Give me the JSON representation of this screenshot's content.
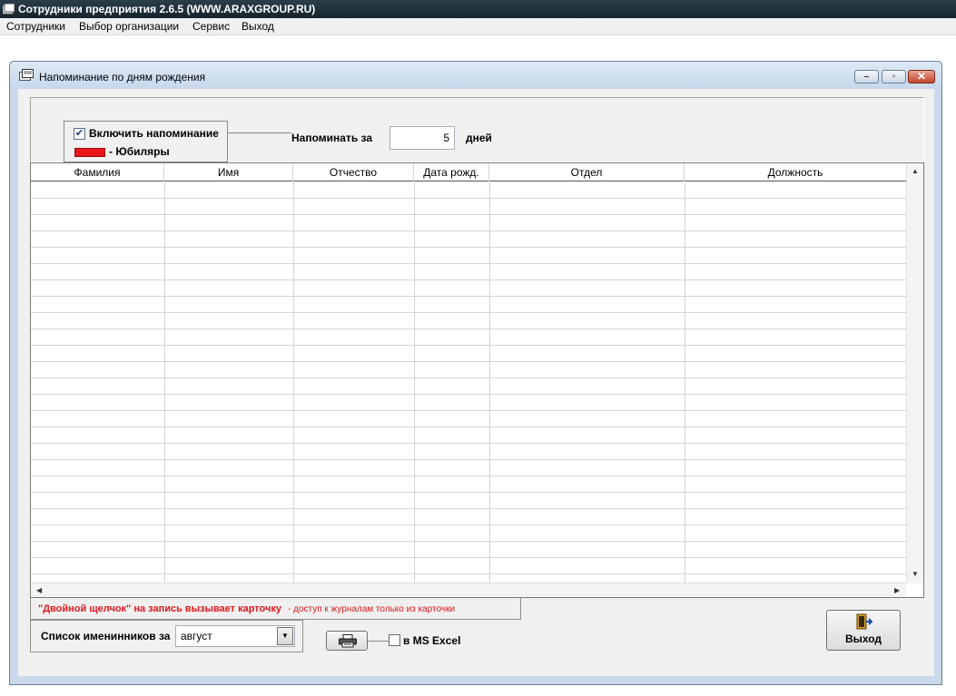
{
  "app": {
    "title": "Сотрудники предприятия 2.6.5  (WWW.ARAXGROUP.RU)"
  },
  "menu": {
    "items": [
      "Сотрудники",
      "Выбор организации",
      "Сервис",
      "Выход"
    ]
  },
  "window": {
    "title": "Напоминание по дням рождения"
  },
  "reminder": {
    "enable_label": "Включить напоминание",
    "enabled": true,
    "jubilee_label": "- Юбиляры",
    "jubilee_color": "#e8161b",
    "remind_for_label": "Напоминать за",
    "days_value": "5",
    "days_label": "дней"
  },
  "table": {
    "columns": [
      "Фамилия",
      "Имя",
      "Отчество",
      "Дата рожд.",
      "Отдел",
      "Должность"
    ],
    "rows": []
  },
  "hints": {
    "double_click": "\"Двойной щелчок\" на запись вызывает карточку",
    "journals": "-  доступ к журналам только из карточки"
  },
  "birthday_list": {
    "label": "Список именинников за",
    "month": "август"
  },
  "export": {
    "excel_label": "в MS Excel",
    "excel_checked": false
  },
  "buttons": {
    "exit_label": "Выход"
  }
}
